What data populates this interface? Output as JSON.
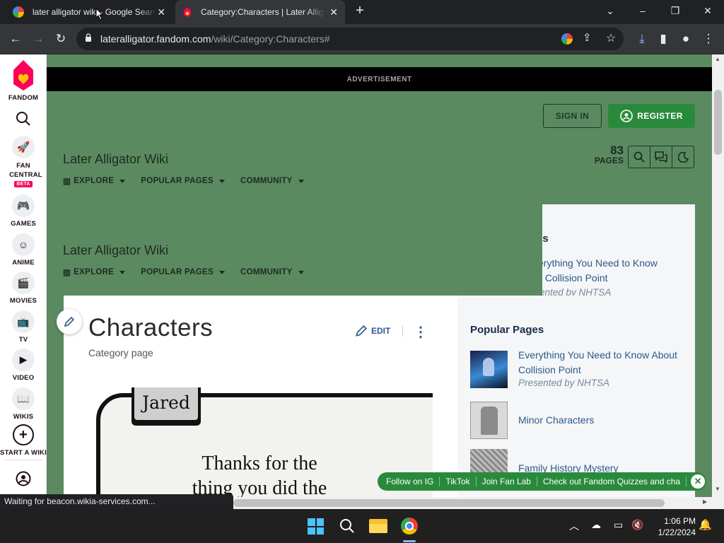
{
  "tabs": [
    {
      "title": "later alligator wiki - Google Search",
      "active": false
    },
    {
      "title": "Category:Characters | Later Alligator Wiki",
      "active": true
    }
  ],
  "address": {
    "host": "lateralligator.fandom.com",
    "path": "/wiki/Category:Characters#"
  },
  "sidebar": {
    "brand": "FANDOM",
    "items": [
      {
        "label": "FAN CENTRAL",
        "badge": "BETA",
        "icon": "rocket-icon"
      },
      {
        "label": "GAMES",
        "icon": "gamepad-icon"
      },
      {
        "label": "ANIME",
        "icon": "anime-face-icon"
      },
      {
        "label": "MOVIES",
        "icon": "clapperboard-icon"
      },
      {
        "label": "TV",
        "icon": "tv-icon"
      },
      {
        "label": "VIDEO",
        "icon": "play-icon"
      },
      {
        "label": "WIKIS",
        "icon": "book-icon"
      },
      {
        "label": "START A WIKI",
        "icon": "plus-circle-icon"
      }
    ]
  },
  "ad": {
    "label": "ADVERTISEMENT"
  },
  "header": {
    "sign_in": "SIGN IN",
    "register": "REGISTER",
    "wiki_title": "Later Alligator Wiki",
    "page_count": "83",
    "page_count_label": "PAGES",
    "nav": [
      "EXPLORE",
      "POPULAR PAGES",
      "COMMUNITY"
    ]
  },
  "sticky": {
    "wiki_title": "Later Alligator Wiki",
    "nav": [
      "EXPLORE",
      "POPULAR PAGES",
      "COMMUNITY"
    ]
  },
  "article": {
    "title": "Characters",
    "subtitle": "Category page",
    "edit": "EDIT",
    "comic": {
      "name": "Jared",
      "speech": "Thanks for the thing you did the"
    }
  },
  "rail_partial": {
    "heading": "es",
    "line1": "erything You Need to Know",
    "line2": "t Collision Point",
    "line3": "ented by NHTSA"
  },
  "popular": {
    "heading": "Popular Pages",
    "items": [
      {
        "title": "Everything You Need to Know About Collision Point",
        "sub": "Presented by NHTSA"
      },
      {
        "title": "Minor Characters",
        "sub": ""
      },
      {
        "title": "Family History Mystery",
        "sub": ""
      }
    ]
  },
  "social": [
    "Follow on IG",
    "TikTok",
    "Join Fan Lab",
    "Check out Fandom Quizzes and cha"
  ],
  "status": "Waiting for beacon.wikia-services.com...",
  "clock": {
    "time": "1:06 PM",
    "date": "1/22/2024"
  },
  "colors": {
    "page_bg": "#5b8a61",
    "register": "#2a8a3c",
    "fandom_brand": "#fa005a",
    "link": "#2d5a8a"
  }
}
